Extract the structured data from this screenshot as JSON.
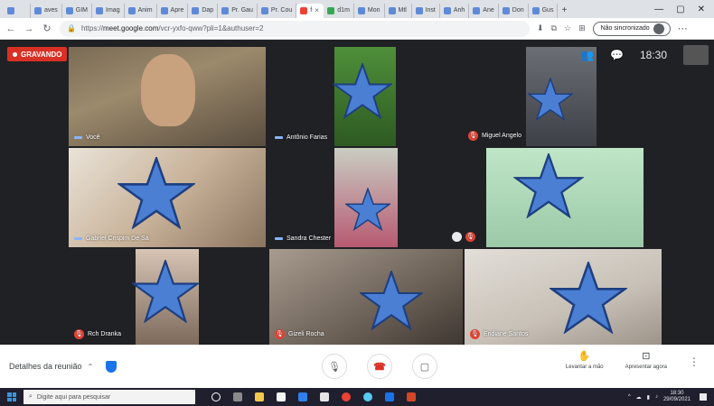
{
  "browser": {
    "tabs": [
      {
        "label": "",
        "icon": "app-icon"
      },
      {
        "label": "aves",
        "icon": "doc-icon"
      },
      {
        "label": "GIM",
        "icon": "doc-icon"
      },
      {
        "label": "Imag",
        "icon": "doc-icon"
      },
      {
        "label": "Anim",
        "icon": "doc-icon"
      },
      {
        "label": "Apre",
        "icon": "doc-icon"
      },
      {
        "label": "Dap",
        "icon": "doc-icon"
      },
      {
        "label": "Pr. Gau",
        "icon": "doc-icon"
      },
      {
        "label": "Pr. Cou",
        "icon": "doc-icon"
      },
      {
        "label": "f",
        "icon": "meet-icon",
        "active": true
      },
      {
        "label": "d1m",
        "icon": "doc-icon"
      },
      {
        "label": "Mon",
        "icon": "doc-icon"
      },
      {
        "label": "Mtl",
        "icon": "doc-icon"
      },
      {
        "label": "Inst",
        "icon": "doc-icon"
      },
      {
        "label": "Anh",
        "icon": "doc-icon"
      },
      {
        "label": "Ane",
        "icon": "doc-icon"
      },
      {
        "label": "Don",
        "icon": "doc-icon"
      },
      {
        "label": "Gus",
        "icon": "doc-icon"
      }
    ],
    "new_tab": "+",
    "window_controls": [
      "—",
      "▢",
      "✕"
    ],
    "url_host": "meet.google.com",
    "url_prefix": "https://",
    "url_path": "/vcr-yxfo-qww?pli=1&authuser=2",
    "incognito_label": "Não sincronizado"
  },
  "meet": {
    "recording_label": "GRAVANDO",
    "time": "18:30",
    "participants": [
      {
        "name": "Você",
        "mic": "on"
      },
      {
        "name": "Antônio Farias",
        "mic": "on"
      },
      {
        "name": "Miguel Angelo",
        "mic": "off"
      },
      {
        "name": "Gabriel Crispim De Sá",
        "mic": "on"
      },
      {
        "name": "Sandra Chester",
        "mic": "on"
      },
      {
        "name": "",
        "mic": "off"
      },
      {
        "name": "Rch Dranka",
        "mic": "off"
      },
      {
        "name": "Gizeli Rocha",
        "mic": "off"
      },
      {
        "name": "Eridiane Santos",
        "mic": "off"
      }
    ],
    "meeting_details_label": "Detalhes da reunião",
    "raise_hand_label": "Levantar a mão",
    "present_label": "Apresentar agora"
  },
  "taskbar": {
    "search_placeholder": "Digite aqui para pesquisar",
    "clock_time": "18:30",
    "clock_date": "29/09/2021"
  },
  "colors": {
    "accent": "#1a73e8",
    "recording": "#d93025",
    "star": "#4a7fd4"
  }
}
